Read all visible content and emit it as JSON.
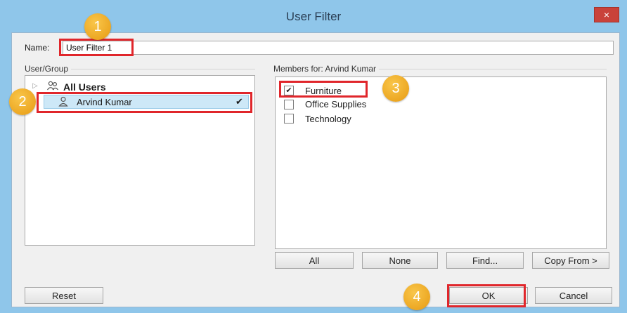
{
  "window": {
    "title": "User Filter",
    "close_glyph": "×"
  },
  "name": {
    "label": "Name:",
    "value": "User Filter 1"
  },
  "user_group": {
    "label": "User/Group",
    "items": [
      {
        "label": "All Users",
        "icon": "users-group-icon"
      },
      {
        "label": "Arvind Kumar",
        "icon": "user-icon",
        "selected": true,
        "check": "✔"
      }
    ]
  },
  "members": {
    "label": "Members for: Arvind Kumar",
    "items": [
      {
        "label": "Furniture",
        "checked": true,
        "mark": "✔"
      },
      {
        "label": "Office Supplies",
        "checked": false,
        "mark": ""
      },
      {
        "label": "Technology",
        "checked": false,
        "mark": ""
      }
    ]
  },
  "buttons": {
    "all": "All",
    "none": "None",
    "find": "Find...",
    "copy_from": "Copy From >",
    "reset": "Reset",
    "ok": "OK",
    "cancel": "Cancel"
  },
  "annotations": [
    "1",
    "2",
    "3",
    "4"
  ],
  "colors": {
    "annotation_red": "#e0262b",
    "badge_orange": "#f0ad2a",
    "selection": "#cde8f7"
  }
}
